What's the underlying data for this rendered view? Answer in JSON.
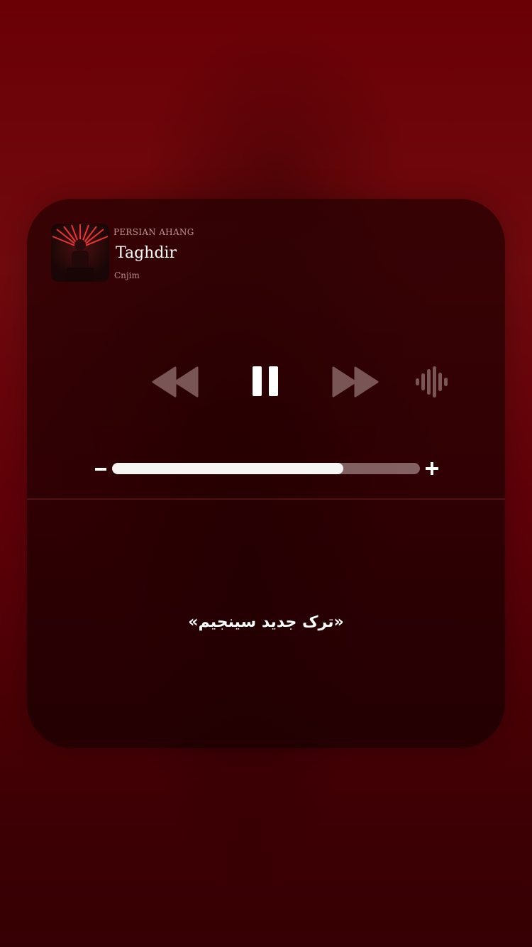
{
  "player": {
    "source_label": "PERSIAN AHANG",
    "track_title": "Taghdir",
    "artist": "Cnjim",
    "artwork_icon": "album-artwork",
    "controls": {
      "rewind_icon": "rewind-icon",
      "pause_icon": "pause-icon",
      "forward_icon": "fast-forward-icon",
      "audio_icon": "waveform-icon"
    },
    "volume": {
      "level": 0.75,
      "minus_icon": "volume-minus-icon",
      "plus_icon": "volume-plus-icon"
    }
  },
  "caption": "«ترک جدید سینجیم»",
  "colors": {
    "background": "#6a0006",
    "panel": "#2a0003",
    "accent": "#ffffff",
    "track": "#c8afaf"
  }
}
